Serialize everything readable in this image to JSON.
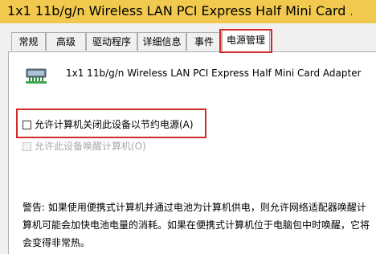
{
  "window": {
    "title": "1x1 11b/g/n Wireless LAN PCI Express Half Mini Card ...",
    "accent_color": "#f0c94e",
    "highlight_color": "#d12a2a"
  },
  "tabs": [
    {
      "label": "常规",
      "active": false
    },
    {
      "label": "高级",
      "active": false
    },
    {
      "label": "驱动程序",
      "active": false
    },
    {
      "label": "详细信息",
      "active": false
    },
    {
      "label": "事件",
      "active": false
    },
    {
      "label": "电源管理",
      "active": true
    }
  ],
  "device": {
    "icon": "network-adapter-icon",
    "name": "1x1 11b/g/n Wireless LAN PCI Express Half Mini Card Adapter"
  },
  "options": {
    "allow_power_off": {
      "label": "允许计算机关闭此设备以节约电源(A)",
      "checked": false,
      "enabled": true
    },
    "allow_wake": {
      "label": "允许此设备唤醒计算机(O)",
      "checked": false,
      "enabled": false
    }
  },
  "warning_text": "警告: 如果使用便携式计算机并通过电池为计算机供电，则允许网络适配器唤醒计算机可能会加快电池电量的消耗。如果在便携式计算机位于电脑包中时唤醒，它将会变得非常热。"
}
